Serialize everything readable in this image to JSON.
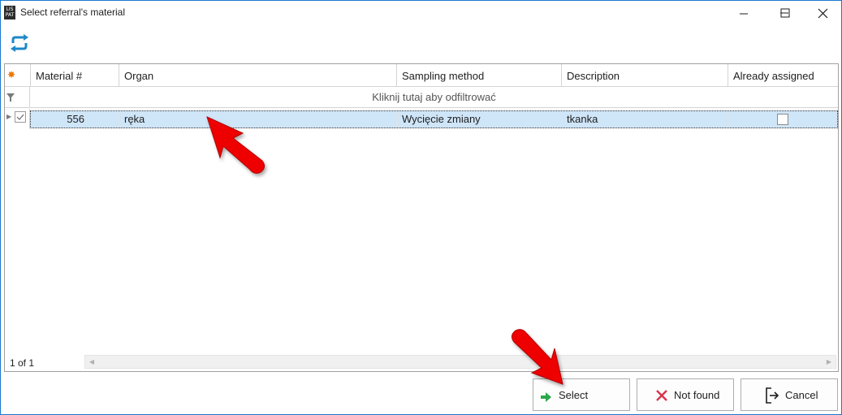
{
  "window": {
    "title": "Select referral's material",
    "logo_text_top": "LIS",
    "logo_text_bottom": "PAT"
  },
  "toolbar": {
    "refresh_icon": "refresh-icon"
  },
  "grid": {
    "columns": [
      "Material #",
      "Organ",
      "Sampling method",
      "Description",
      "Already assigned"
    ],
    "filter_prompt": "Kliknij tutaj aby odfiltrować",
    "rows": [
      {
        "material": "556",
        "organ": "ręka",
        "sampling_method": "Wycięcie zmiany",
        "description": "tkanka",
        "already_assigned": false
      }
    ],
    "page_info": "1 of 1"
  },
  "buttons": {
    "select": "Select",
    "not_found": "Not found",
    "cancel": "Cancel"
  },
  "colors": {
    "selected_row": "#cfe5f8",
    "accent_blue": "#1a7ad0",
    "annotation_red": "#e60000"
  }
}
